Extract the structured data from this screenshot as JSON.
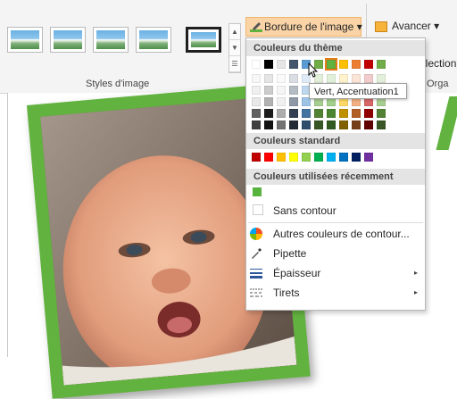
{
  "ribbon": {
    "group_label": "Styles d'image",
    "border_button_label": "Bordure de l'image",
    "border_button_caret": "▾",
    "forward_label": "Avancer",
    "forward_caret": "▾",
    "selection_label_cut": "élection",
    "organize_label_cut": "Orga",
    "scroll_up": "▲",
    "scroll_down": "▼",
    "scroll_more": "☰"
  },
  "panel": {
    "theme_title": "Couleurs du thème",
    "standard_title": "Couleurs standard",
    "recent_title": "Couleurs utilisées récemment",
    "no_outline": "Sans contour",
    "more_colors": "Autres couleurs de contour...",
    "eyedropper": "Pipette",
    "weight": "Épaisseur",
    "dashes": "Tirets",
    "submenu_arrow": "▸",
    "tooltip": "Vert, Accentuation1"
  },
  "colors": {
    "accent": "#62b23f",
    "highlight": "#fad4a7",
    "theme_row": [
      "#ffffff",
      "#000000",
      "#e7e6e6",
      "#44546a",
      "#5b9bd5",
      "#70ad47",
      "#62b23f",
      "#ffc000",
      "#ed7d31",
      "#c00000",
      "#70ad47"
    ],
    "standard_row": [
      "#c00000",
      "#ff0000",
      "#ffc000",
      "#ffff00",
      "#92d050",
      "#00b050",
      "#00b0f0",
      "#0070c0",
      "#002060",
      "#7030a0"
    ],
    "recent": "#57b33c"
  }
}
